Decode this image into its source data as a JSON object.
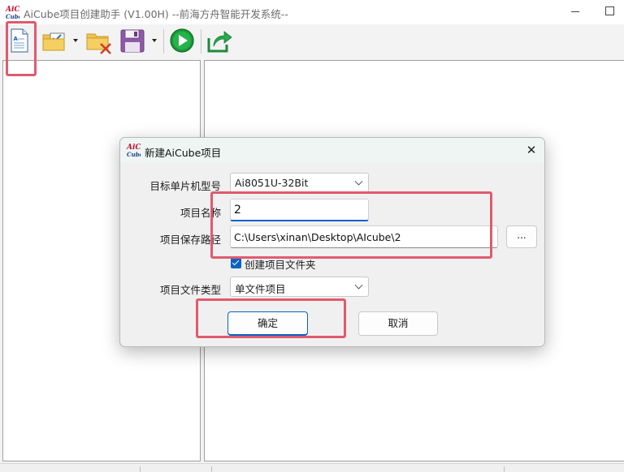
{
  "window": {
    "title": "AiCube项目创建助手 (V1.00H) --前海方舟智能开发系统--",
    "logo_text_top": "AiC",
    "logo_text_bottom": "Cube"
  },
  "toolbar": {
    "buttons": [
      {
        "name": "new-project",
        "icon": "new-document-icon"
      },
      {
        "name": "open-project",
        "icon": "open-folder-check-icon",
        "has_dropdown": true
      },
      {
        "name": "close-project",
        "icon": "folder-delete-icon"
      },
      {
        "name": "save-project",
        "icon": "save-disk-icon",
        "has_dropdown": true
      },
      {
        "name": "run",
        "icon": "play-icon"
      },
      {
        "name": "export",
        "icon": "share-export-icon"
      }
    ]
  },
  "dialog": {
    "title": "新建AiCube项目",
    "logo_text_top": "AiC",
    "logo_text_bottom": "Cube",
    "close_label": "✕",
    "mcu_label": "目标单片机型号",
    "mcu_value": "Ai8051U-32Bit",
    "name_label": "项目名称",
    "name_value": "2",
    "path_label": "项目保存路径",
    "path_value": "C:\\Users\\xinan\\Desktop\\AIcube\\2",
    "browse_label": "...",
    "create_folder_label": "创建项目文件夹",
    "create_folder_checked": true,
    "filetype_label": "项目文件类型",
    "filetype_value": "单文件项目",
    "ok_label": "确定",
    "cancel_label": "取消"
  },
  "colors": {
    "accent": "#0a62c4",
    "highlight": "#e05a6e",
    "dialog_title_bg": "#eef5f3"
  }
}
